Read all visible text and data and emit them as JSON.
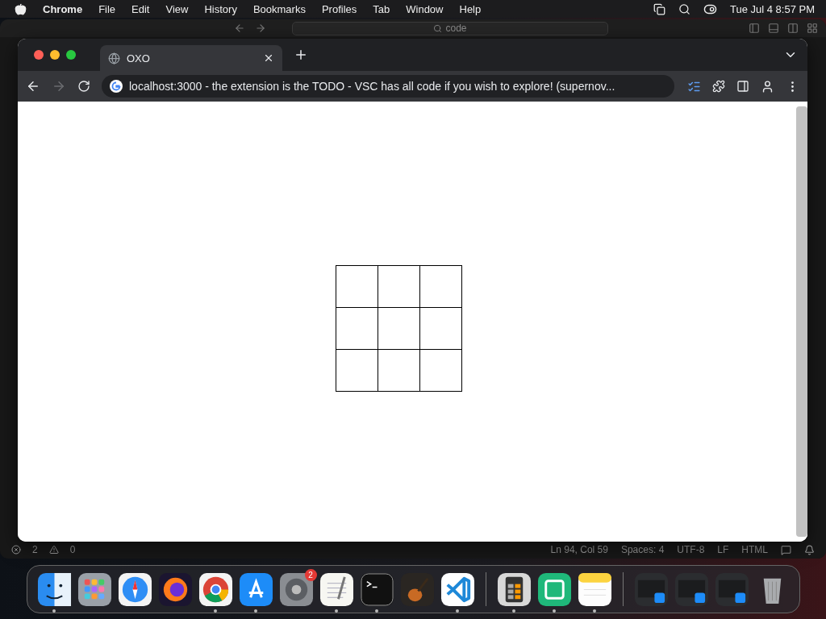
{
  "menu_bar": {
    "app": "Chrome",
    "items": [
      "File",
      "Edit",
      "View",
      "History",
      "Bookmarks",
      "Profiles",
      "Tab",
      "Window",
      "Help"
    ],
    "clock": "Tue Jul 4  8:57 PM"
  },
  "editor": {
    "search": "code",
    "status_bar": {
      "errors": "2",
      "warnings": "0",
      "items": [
        "Ln 94, Col 59",
        "Spaces: 4",
        "UTF-8",
        "LF",
        "HTML"
      ]
    }
  },
  "browser": {
    "tabs": [
      {
        "title": "OXO",
        "selected": true
      }
    ],
    "forward_disabled": true,
    "address": "localhost:3000 - the extension is the TODO  - VSC has all code if you wish to explore!  (supernov...",
    "board": [
      {
        "kind": "empty"
      },
      {
        "kind": "empty"
      },
      {
        "kind": "empty"
      },
      {
        "kind": "empty"
      },
      {
        "kind": "empty"
      },
      {
        "kind": "empty"
      },
      {
        "kind": "empty"
      },
      {
        "kind": "empty"
      },
      {
        "kind": "empty"
      }
    ]
  },
  "dock": [
    {
      "kind": "finder",
      "running": true
    },
    {
      "kind": "launchpad",
      "running": false
    },
    {
      "kind": "safari",
      "running": false
    },
    {
      "kind": "firefox",
      "running": false
    },
    {
      "kind": "chrome",
      "running": true
    },
    {
      "kind": "appstore",
      "running": true
    },
    {
      "kind": "settings",
      "running": false,
      "badge": "2"
    },
    {
      "kind": "textedit",
      "running": true
    },
    {
      "kind": "terminal",
      "running": true
    },
    {
      "kind": "garageband",
      "running": false
    },
    {
      "kind": "vscode",
      "running": true
    },
    {
      "kind": "divider"
    },
    {
      "kind": "calculator",
      "running": true
    },
    {
      "kind": "green",
      "running": true
    },
    {
      "kind": "notes",
      "running": true
    },
    {
      "kind": "divider"
    },
    {
      "kind": "window",
      "running": false
    },
    {
      "kind": "window",
      "running": false
    },
    {
      "kind": "window",
      "running": false
    },
    {
      "kind": "trash",
      "running": false
    }
  ]
}
